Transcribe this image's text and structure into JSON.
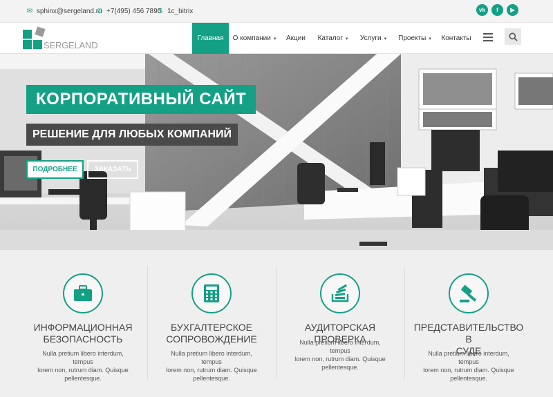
{
  "topbar": {
    "email": "sphinx@sergeland.ru",
    "phone": "+7(495) 456 7890",
    "skype": "1c_bitrix",
    "email_icon": "envelope-icon",
    "phone_icon": "phone-icon",
    "skype_icon": "skype-icon",
    "social": [
      {
        "icon": "vk-icon",
        "label": "vk"
      },
      {
        "icon": "facebook-icon",
        "label": "f"
      },
      {
        "icon": "youtube-icon",
        "label": "▶"
      }
    ]
  },
  "header": {
    "logo_text": "SERGELAND",
    "nav": [
      {
        "label": "Главная",
        "active": true,
        "dropdown": false
      },
      {
        "label": "О компании",
        "active": false,
        "dropdown": true
      },
      {
        "label": "Акции",
        "active": false,
        "dropdown": false
      },
      {
        "label": "Каталог",
        "active": false,
        "dropdown": true
      },
      {
        "label": "Услуги",
        "active": false,
        "dropdown": true
      },
      {
        "label": "Проекты",
        "active": false,
        "dropdown": true
      },
      {
        "label": "Контакты",
        "active": false,
        "dropdown": false
      }
    ],
    "caret": "▾",
    "menu_icon": "hamburger-icon",
    "search_icon": "search-icon"
  },
  "hero": {
    "title": "КОРПОРАТИВНЫЙ САЙТ",
    "subtitle": "РЕШЕНИЕ ДЛЯ ЛЮБЫХ КОМПАНИЙ",
    "button_more": "ПОДРОБНЕЕ",
    "button_order": "ЗАКАЗАТЬ"
  },
  "services": [
    {
      "icon": "briefcase-icon",
      "title_line1": "ИНФОРМАЦИОННАЯ",
      "title_line2": "БЕЗОПАСНОСТЬ",
      "text_line1": "Nulla pretium libero interdum, tempus",
      "text_line2": "lorem non, rutrum diam. Quisque",
      "text_line3": "pellentesque."
    },
    {
      "icon": "calculator-icon",
      "title_line1": "БУХГАЛТЕРСКОЕ",
      "title_line2": "СОПРОВОЖДЕНИЕ",
      "text_line1": "Nulla pretium libero interdum, tempus",
      "text_line2": "lorem non, rutrum diam. Quisque",
      "text_line3": "pellentesque."
    },
    {
      "icon": "stack-icon",
      "title_line1": "АУДИТОРСКАЯ ПРОВЕРКА",
      "title_line2": "",
      "text_line1": "Nulla pretium libero interdum, tempus",
      "text_line2": "lorem non, rutrum diam. Quisque",
      "text_line3": "pellentesque."
    },
    {
      "icon": "gavel-icon",
      "title_line1": "ПРЕДСТАВИТЕЛЬСТВО В",
      "title_line2": "СУДЕ",
      "text_line1": "Nulla pretium libero interdum, tempus",
      "text_line2": "lorem non, rutrum diam. Quisque",
      "text_line3": "pellentesque."
    }
  ],
  "colors": {
    "accent": "#14a085",
    "dark_label": "#4a4a4a",
    "topbar_bg": "#f3f3f3",
    "services_bg": "#efefef"
  }
}
